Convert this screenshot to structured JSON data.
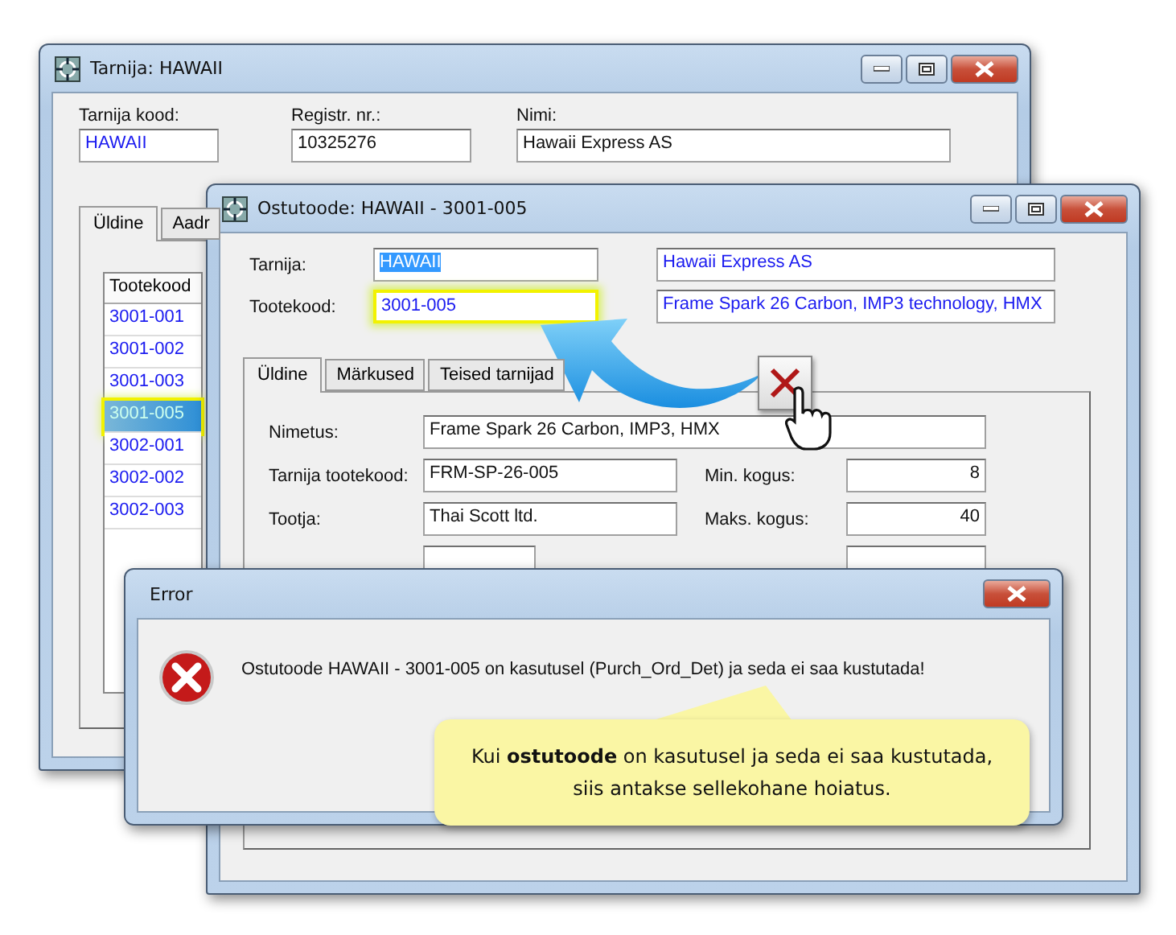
{
  "supplier_window": {
    "title": "Tarnija: HAWAII",
    "fields": [
      {
        "label": "Tarnija kood:",
        "value": "HAWAII",
        "kind": "code"
      },
      {
        "label": "Registr. nr.:",
        "value": "10325276",
        "kind": "text"
      },
      {
        "label": "Nimi:",
        "value": "Hawaii Express AS",
        "kind": "text"
      }
    ],
    "tabs": [
      {
        "label": "Üldine",
        "selected": true
      },
      {
        "label": "Aadr",
        "selected": false
      }
    ],
    "table": {
      "columns": [
        "Tootekood"
      ],
      "rows": [
        {
          "cells": [
            "3001-001"
          ],
          "selected": false
        },
        {
          "cells": [
            "3001-002"
          ],
          "selected": false
        },
        {
          "cells": [
            "3001-003"
          ],
          "selected": false
        },
        {
          "cells": [
            "3001-005"
          ],
          "selected": true
        },
        {
          "cells": [
            "3002-001"
          ],
          "selected": false
        },
        {
          "cells": [
            "3002-002"
          ],
          "selected": false
        },
        {
          "cells": [
            "3002-003"
          ],
          "selected": false
        }
      ]
    }
  },
  "product_window": {
    "title": "Ostutoode: HAWAII - 3001-005",
    "header_rows": [
      {
        "label": "Tarnija:",
        "code": "HAWAII",
        "name": "Hawaii Express AS",
        "highlighted": false,
        "text_selected": true
      },
      {
        "label": "Tootekood:",
        "code": "3001-005",
        "name": "Frame Spark 26 Carbon, IMP3 technology, HMX",
        "highlighted": true,
        "text_selected": false
      }
    ],
    "tabs": [
      {
        "label": "Üldine",
        "selected": true
      },
      {
        "label": "Märkused",
        "selected": false
      },
      {
        "label": "Teised tarnijad",
        "selected": false
      }
    ],
    "form_rows": [
      {
        "fields": [
          {
            "label": "Nimetus:",
            "value": "Frame Spark 26 Carbon, IMP3, HMX",
            "kind": "wide"
          }
        ]
      },
      {
        "fields": [
          {
            "label": "Tarnija tootekood:",
            "value": "FRM-SP-26-005",
            "kind": "text"
          },
          {
            "label": "Min. kogus:",
            "value": "8",
            "kind": "number"
          }
        ]
      },
      {
        "fields": [
          {
            "label": "Tootja:",
            "value": "Thai Scott ltd.",
            "kind": "text"
          },
          {
            "label": "Maks. kogus:",
            "value": "40",
            "kind": "number"
          }
        ]
      }
    ]
  },
  "error_dialog": {
    "title": "Error",
    "message": "Ostutoode HAWAII - 3001-005 on kasutusel (Purch_Ord_Det) ja seda ei saa kustutada!"
  },
  "callout": {
    "text": "Kui **ostutoode** on kasutusel ja seda ei saa kustutada, siis antakse sellekohane hoiatus."
  }
}
